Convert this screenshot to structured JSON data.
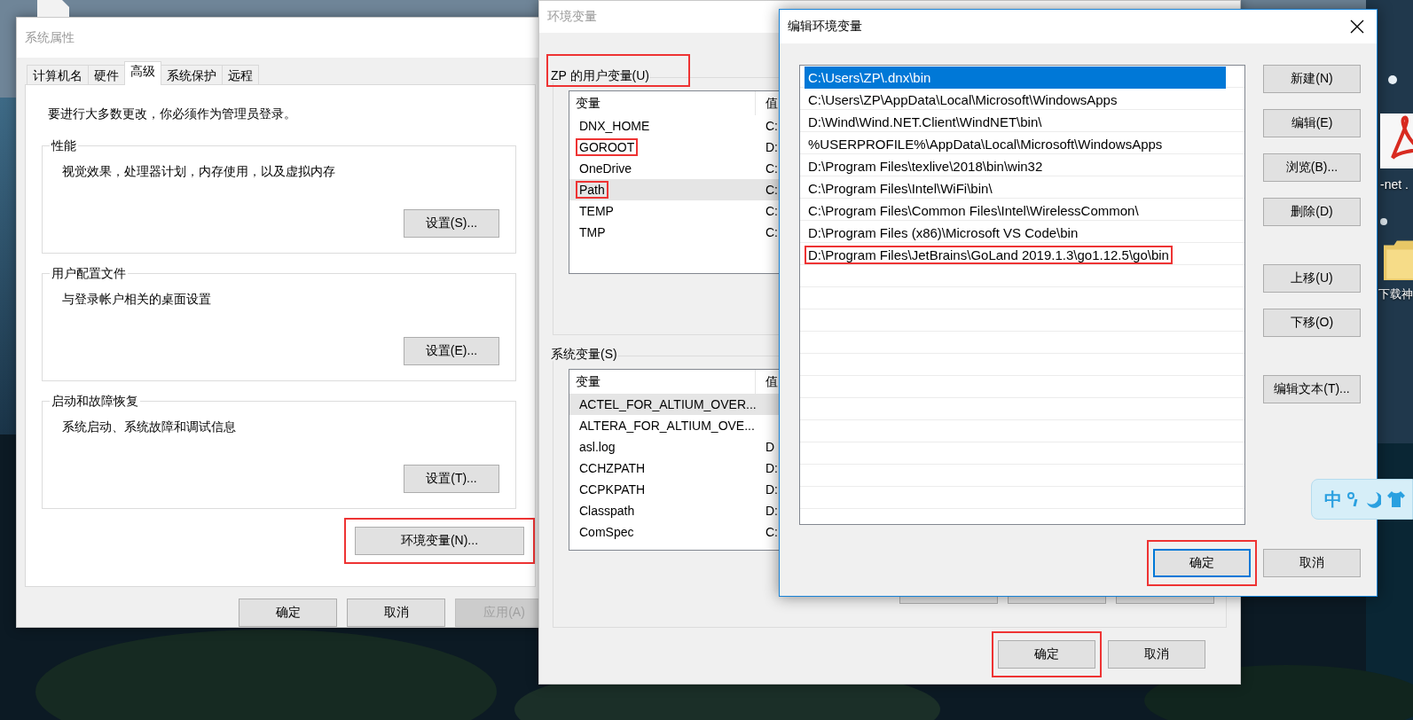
{
  "desktop": {
    "icon_labels": [
      "-net .",
      "下载神"
    ],
    "ime_bar": {
      "mode": "中"
    }
  },
  "system_properties": {
    "title": "系统属性",
    "active": false,
    "tabs": [
      {
        "label": "计算机名",
        "selected": false
      },
      {
        "label": "硬件",
        "selected": false
      },
      {
        "label": "高级",
        "selected": true
      },
      {
        "label": "系统保护",
        "selected": false
      },
      {
        "label": "远程",
        "selected": false
      }
    ],
    "notice": "要进行大多数更改，你必须作为管理员登录。",
    "groups": [
      {
        "title": "性能",
        "description": "视觉效果，处理器计划，内存使用，以及虚拟内存",
        "button": "设置(S)..."
      },
      {
        "title": "用户配置文件",
        "description": "与登录帐户相关的桌面设置",
        "button": "设置(E)..."
      },
      {
        "title": "启动和故障恢复",
        "description": "系统启动、系统故障和调试信息",
        "button": "设置(T)..."
      }
    ],
    "env_button": {
      "label": "环境变量(N)...",
      "highlighted": true
    },
    "buttons": [
      {
        "label": "确定",
        "disabled": false
      },
      {
        "label": "取消",
        "disabled": false
      },
      {
        "label": "应用(A)",
        "disabled": true
      }
    ]
  },
  "environment_variables": {
    "title": "环境变量",
    "active": false,
    "user_section": {
      "title": "ZP 的用户变量(U)",
      "highlighted": true,
      "columns": [
        "变量",
        "值"
      ],
      "rows": [
        {
          "name": "DNX_HOME",
          "value": "C:",
          "selected": false,
          "highlighted": false
        },
        {
          "name": "GOROOT",
          "value": "D:",
          "selected": false,
          "highlighted": true
        },
        {
          "name": "OneDrive",
          "value": "C:",
          "selected": false,
          "highlighted": false
        },
        {
          "name": "Path",
          "value": "C:",
          "selected": true,
          "highlighted": true
        },
        {
          "name": "TEMP",
          "value": "C:",
          "selected": false,
          "highlighted": false
        },
        {
          "name": "TMP",
          "value": "C:",
          "selected": false,
          "highlighted": false
        }
      ]
    },
    "system_section": {
      "title": "系统变量(S)",
      "highlighted": false,
      "columns": [
        "变量",
        "值"
      ],
      "rows": [
        {
          "name": "ACTEL_FOR_ALTIUM_OVER...",
          "value": "",
          "selected": true,
          "highlighted": false
        },
        {
          "name": "ALTERA_FOR_ALTIUM_OVE...",
          "value": "",
          "selected": false,
          "highlighted": false
        },
        {
          "name": "asl.log",
          "value": "D",
          "selected": false,
          "highlighted": false
        },
        {
          "name": "CCHZPATH",
          "value": "D:",
          "selected": false,
          "highlighted": false
        },
        {
          "name": "CCPKPATH",
          "value": "D:",
          "selected": false,
          "highlighted": false
        },
        {
          "name": "Classpath",
          "value": "D:",
          "selected": false,
          "highlighted": false
        },
        {
          "name": "ComSpec",
          "value": "C:",
          "selected": false,
          "highlighted": false
        }
      ]
    },
    "buttons": [
      {
        "label": "确定",
        "highlighted": true
      },
      {
        "label": "取消",
        "highlighted": false
      }
    ]
  },
  "edit_environment_variable": {
    "title": "编辑环境变量",
    "active": true,
    "entries": [
      {
        "text": "C:\\Users\\ZP\\.dnx\\bin",
        "selected": true,
        "highlighted": false
      },
      {
        "text": "C:\\Users\\ZP\\AppData\\Local\\Microsoft\\WindowsApps",
        "selected": false,
        "highlighted": false
      },
      {
        "text": "D:\\Wind\\Wind.NET.Client\\WindNET\\bin\\",
        "selected": false,
        "highlighted": false
      },
      {
        "text": "%USERPROFILE%\\AppData\\Local\\Microsoft\\WindowsApps",
        "selected": false,
        "highlighted": false
      },
      {
        "text": "D:\\Program Files\\texlive\\2018\\bin\\win32",
        "selected": false,
        "highlighted": false
      },
      {
        "text": "C:\\Program Files\\Intel\\WiFi\\bin\\",
        "selected": false,
        "highlighted": false
      },
      {
        "text": "C:\\Program Files\\Common Files\\Intel\\WirelessCommon\\",
        "selected": false,
        "highlighted": false
      },
      {
        "text": "D:\\Program Files (x86)\\Microsoft VS Code\\bin",
        "selected": false,
        "highlighted": false
      },
      {
        "text": "D:\\Program Files\\JetBrains\\GoLand 2019.1.3\\go1.12.5\\go\\bin",
        "selected": false,
        "highlighted": true
      }
    ],
    "side_button_groups": [
      [
        "新建(N)",
        "编辑(E)",
        "浏览(B)...",
        "删除(D)"
      ],
      [
        "上移(U)",
        "下移(O)"
      ],
      [
        "编辑文本(T)..."
      ]
    ],
    "buttons": [
      {
        "label": "确定",
        "default": true,
        "highlighted": true
      },
      {
        "label": "取消",
        "default": false,
        "highlighted": false
      }
    ]
  }
}
